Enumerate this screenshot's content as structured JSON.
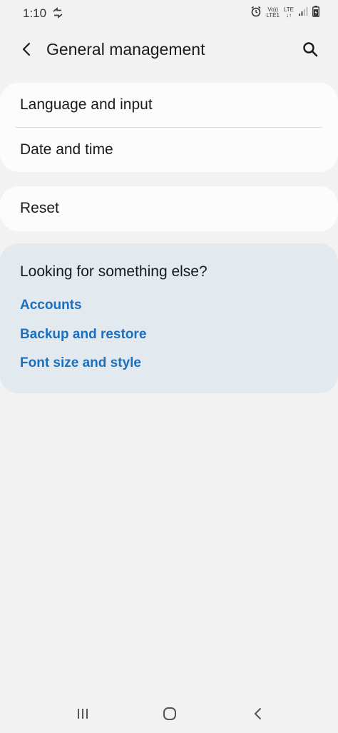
{
  "status_bar": {
    "time": "1:10",
    "volte_top": "Vo))",
    "volte_bottom": "LTE1",
    "lte": "LTE"
  },
  "header": {
    "title": "General management"
  },
  "settings": {
    "items": [
      {
        "label": "Language and input"
      },
      {
        "label": "Date and time"
      },
      {
        "label": "Reset"
      }
    ]
  },
  "suggestions": {
    "title": "Looking for something else?",
    "links": [
      {
        "label": "Accounts"
      },
      {
        "label": "Backup and restore"
      },
      {
        "label": "Font size and style"
      }
    ]
  },
  "colors": {
    "background": "#f2f2f2",
    "card": "#fcfcfc",
    "suggestion_card": "#e2e9ef",
    "link": "#1b6fbd"
  },
  "icons": {
    "back": "chevron-left-icon",
    "search": "search-icon",
    "nav_recents": "recents-icon",
    "nav_home": "home-icon",
    "nav_back": "back-icon"
  }
}
